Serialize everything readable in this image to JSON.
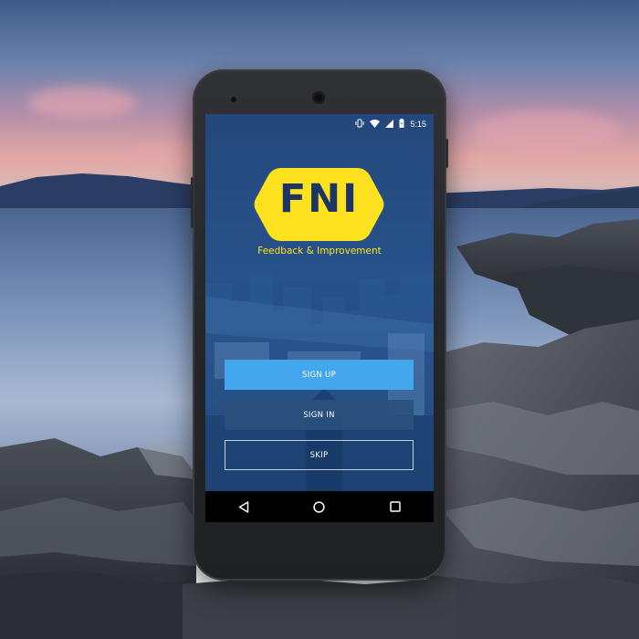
{
  "status_bar": {
    "time": "5:15",
    "icons": [
      "vibrate-icon",
      "wifi-icon",
      "signal-icon",
      "battery-icon"
    ]
  },
  "logo": {
    "text": "FNI",
    "color": "#ffe21f"
  },
  "tagline": "Feedback & Improvement",
  "buttons": {
    "signup": "SIGN UP",
    "signin": "SIGN IN",
    "skip": "SKIP"
  },
  "nav_bar": {
    "icons": [
      "back-icon",
      "home-icon",
      "recents-icon"
    ]
  },
  "colors": {
    "accent": "#44a7ee",
    "brand_yellow": "#ffe21f",
    "brand_navy": "#1c3566"
  }
}
